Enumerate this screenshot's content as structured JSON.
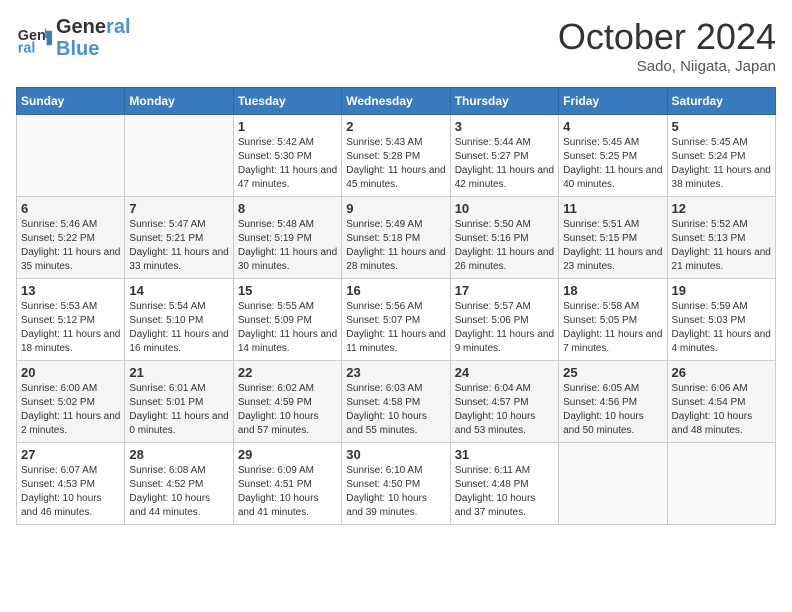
{
  "header": {
    "logo_line1": "General",
    "logo_line2": "Blue",
    "month": "October 2024",
    "location": "Sado, Niigata, Japan"
  },
  "weekdays": [
    "Sunday",
    "Monday",
    "Tuesday",
    "Wednesday",
    "Thursday",
    "Friday",
    "Saturday"
  ],
  "weeks": [
    [
      {
        "day": "",
        "info": ""
      },
      {
        "day": "",
        "info": ""
      },
      {
        "day": "1",
        "info": "Sunrise: 5:42 AM\nSunset: 5:30 PM\nDaylight: 11 hours and 47 minutes."
      },
      {
        "day": "2",
        "info": "Sunrise: 5:43 AM\nSunset: 5:28 PM\nDaylight: 11 hours and 45 minutes."
      },
      {
        "day": "3",
        "info": "Sunrise: 5:44 AM\nSunset: 5:27 PM\nDaylight: 11 hours and 42 minutes."
      },
      {
        "day": "4",
        "info": "Sunrise: 5:45 AM\nSunset: 5:25 PM\nDaylight: 11 hours and 40 minutes."
      },
      {
        "day": "5",
        "info": "Sunrise: 5:45 AM\nSunset: 5:24 PM\nDaylight: 11 hours and 38 minutes."
      }
    ],
    [
      {
        "day": "6",
        "info": "Sunrise: 5:46 AM\nSunset: 5:22 PM\nDaylight: 11 hours and 35 minutes."
      },
      {
        "day": "7",
        "info": "Sunrise: 5:47 AM\nSunset: 5:21 PM\nDaylight: 11 hours and 33 minutes."
      },
      {
        "day": "8",
        "info": "Sunrise: 5:48 AM\nSunset: 5:19 PM\nDaylight: 11 hours and 30 minutes."
      },
      {
        "day": "9",
        "info": "Sunrise: 5:49 AM\nSunset: 5:18 PM\nDaylight: 11 hours and 28 minutes."
      },
      {
        "day": "10",
        "info": "Sunrise: 5:50 AM\nSunset: 5:16 PM\nDaylight: 11 hours and 26 minutes."
      },
      {
        "day": "11",
        "info": "Sunrise: 5:51 AM\nSunset: 5:15 PM\nDaylight: 11 hours and 23 minutes."
      },
      {
        "day": "12",
        "info": "Sunrise: 5:52 AM\nSunset: 5:13 PM\nDaylight: 11 hours and 21 minutes."
      }
    ],
    [
      {
        "day": "13",
        "info": "Sunrise: 5:53 AM\nSunset: 5:12 PM\nDaylight: 11 hours and 18 minutes."
      },
      {
        "day": "14",
        "info": "Sunrise: 5:54 AM\nSunset: 5:10 PM\nDaylight: 11 hours and 16 minutes."
      },
      {
        "day": "15",
        "info": "Sunrise: 5:55 AM\nSunset: 5:09 PM\nDaylight: 11 hours and 14 minutes."
      },
      {
        "day": "16",
        "info": "Sunrise: 5:56 AM\nSunset: 5:07 PM\nDaylight: 11 hours and 11 minutes."
      },
      {
        "day": "17",
        "info": "Sunrise: 5:57 AM\nSunset: 5:06 PM\nDaylight: 11 hours and 9 minutes."
      },
      {
        "day": "18",
        "info": "Sunrise: 5:58 AM\nSunset: 5:05 PM\nDaylight: 11 hours and 7 minutes."
      },
      {
        "day": "19",
        "info": "Sunrise: 5:59 AM\nSunset: 5:03 PM\nDaylight: 11 hours and 4 minutes."
      }
    ],
    [
      {
        "day": "20",
        "info": "Sunrise: 6:00 AM\nSunset: 5:02 PM\nDaylight: 11 hours and 2 minutes."
      },
      {
        "day": "21",
        "info": "Sunrise: 6:01 AM\nSunset: 5:01 PM\nDaylight: 11 hours and 0 minutes."
      },
      {
        "day": "22",
        "info": "Sunrise: 6:02 AM\nSunset: 4:59 PM\nDaylight: 10 hours and 57 minutes."
      },
      {
        "day": "23",
        "info": "Sunrise: 6:03 AM\nSunset: 4:58 PM\nDaylight: 10 hours and 55 minutes."
      },
      {
        "day": "24",
        "info": "Sunrise: 6:04 AM\nSunset: 4:57 PM\nDaylight: 10 hours and 53 minutes."
      },
      {
        "day": "25",
        "info": "Sunrise: 6:05 AM\nSunset: 4:56 PM\nDaylight: 10 hours and 50 minutes."
      },
      {
        "day": "26",
        "info": "Sunrise: 6:06 AM\nSunset: 4:54 PM\nDaylight: 10 hours and 48 minutes."
      }
    ],
    [
      {
        "day": "27",
        "info": "Sunrise: 6:07 AM\nSunset: 4:53 PM\nDaylight: 10 hours and 46 minutes."
      },
      {
        "day": "28",
        "info": "Sunrise: 6:08 AM\nSunset: 4:52 PM\nDaylight: 10 hours and 44 minutes."
      },
      {
        "day": "29",
        "info": "Sunrise: 6:09 AM\nSunset: 4:51 PM\nDaylight: 10 hours and 41 minutes."
      },
      {
        "day": "30",
        "info": "Sunrise: 6:10 AM\nSunset: 4:50 PM\nDaylight: 10 hours and 39 minutes."
      },
      {
        "day": "31",
        "info": "Sunrise: 6:11 AM\nSunset: 4:48 PM\nDaylight: 10 hours and 37 minutes."
      },
      {
        "day": "",
        "info": ""
      },
      {
        "day": "",
        "info": ""
      }
    ]
  ]
}
